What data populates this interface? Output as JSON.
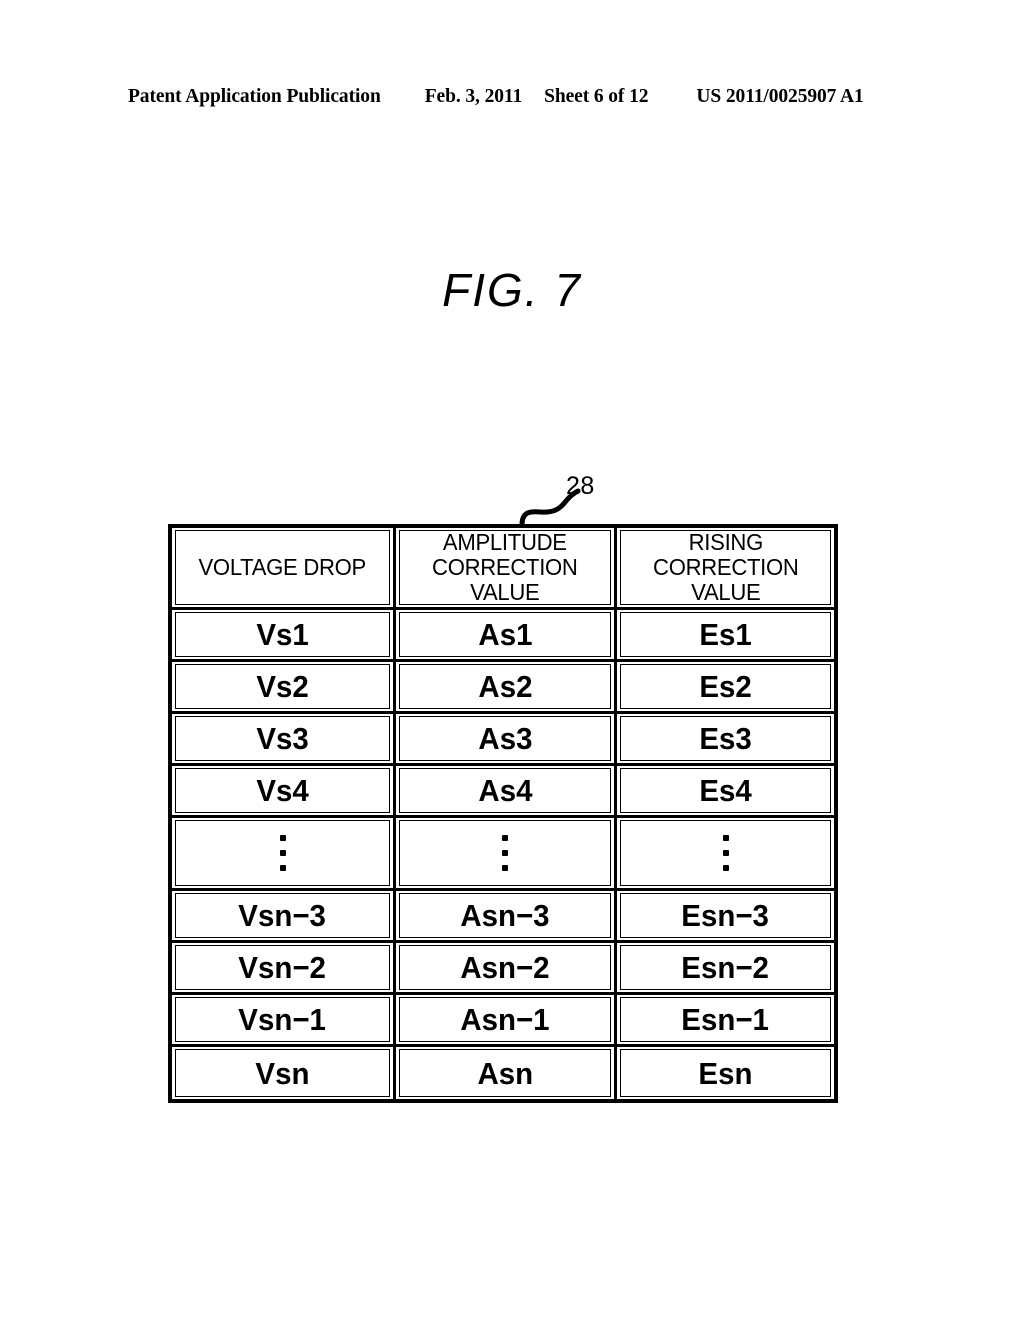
{
  "page_header": {
    "publication": "Patent Application Publication",
    "date": "Feb. 3, 2011",
    "sheet": "Sheet 6 of 12",
    "patent_number": "US 2011/0025907 A1"
  },
  "figure": {
    "title": "FIG. 7",
    "reference_numeral": "28"
  },
  "table": {
    "columns": [
      {
        "header": "VOLTAGE DROP",
        "lines": [
          "VOLTAGE DROP"
        ]
      },
      {
        "header": "AMPLITUDE CORRECTION VALUE",
        "lines": [
          "AMPLITUDE",
          "CORRECTION",
          "VALUE"
        ]
      },
      {
        "header": "RISING CORRECTION VALUE",
        "lines": [
          "RISING",
          "CORRECTION",
          "VALUE"
        ]
      }
    ],
    "rows": [
      {
        "type": "data",
        "cells": [
          "Vs1",
          "As1",
          "Es1"
        ]
      },
      {
        "type": "data",
        "cells": [
          "Vs2",
          "As2",
          "Es2"
        ]
      },
      {
        "type": "data",
        "cells": [
          "Vs3",
          "As3",
          "Es3"
        ]
      },
      {
        "type": "data",
        "cells": [
          "Vs4",
          "As4",
          "Es4"
        ]
      },
      {
        "type": "ellipsis",
        "cells": [
          "",
          "",
          ""
        ]
      },
      {
        "type": "data",
        "cells": [
          "Vsn−3",
          "Asn−3",
          "Esn−3"
        ]
      },
      {
        "type": "data",
        "cells": [
          "Vsn−2",
          "Asn−2",
          "Esn−2"
        ]
      },
      {
        "type": "data",
        "cells": [
          "Vsn−1",
          "Asn−1",
          "Esn−1"
        ]
      },
      {
        "type": "data",
        "cells": [
          "Vsn",
          "Asn",
          "Esn"
        ]
      }
    ]
  },
  "colors": {
    "ink": "#000000",
    "paper": "#ffffff"
  }
}
